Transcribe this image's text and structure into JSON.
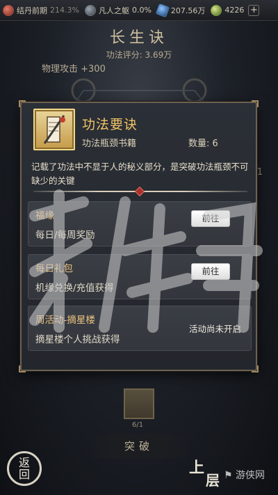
{
  "topbar": {
    "realm_label": "结丹前期",
    "realm_progress": "214.3%",
    "trait_label": "凡人之躯",
    "trait_progress": "0.0%",
    "crystal_amount": "207.56万",
    "jade_amount": "4226",
    "plus": "+"
  },
  "page": {
    "title": "长生诀",
    "score": "功法评分: 3.69万",
    "attack": "物理攻击 +300",
    "side_digit": "1"
  },
  "modal": {
    "item_name": "功法要诀",
    "item_type": "功法瓶颈书籍",
    "item_qty": "数量: 6",
    "description": "记载了功法中不显于人的秘义部分，是突破功法瓶颈不可缺少的关键",
    "sources": [
      {
        "title": "福缘",
        "subtitle": "每日/每周奖励",
        "action": "前往"
      },
      {
        "title": "每日礼包",
        "subtitle": "机缘兑换/充值获得",
        "action": "前往"
      },
      {
        "title": "周活动-摘星楼",
        "subtitle": "摘星楼个人挑战获得",
        "status": "活动尚未开启"
      }
    ]
  },
  "bottom": {
    "item_count": "6/1",
    "breakthrough": "突破",
    "back_top": "返",
    "back_bottom": "回",
    "upper_a": "上",
    "upper_b": "层",
    "watermark_logo": "⚑ 游侠网"
  },
  "colors": {
    "accent_gold": "#f0c466",
    "source_title": "#ecc27e",
    "modal_border": "#6e6150"
  }
}
